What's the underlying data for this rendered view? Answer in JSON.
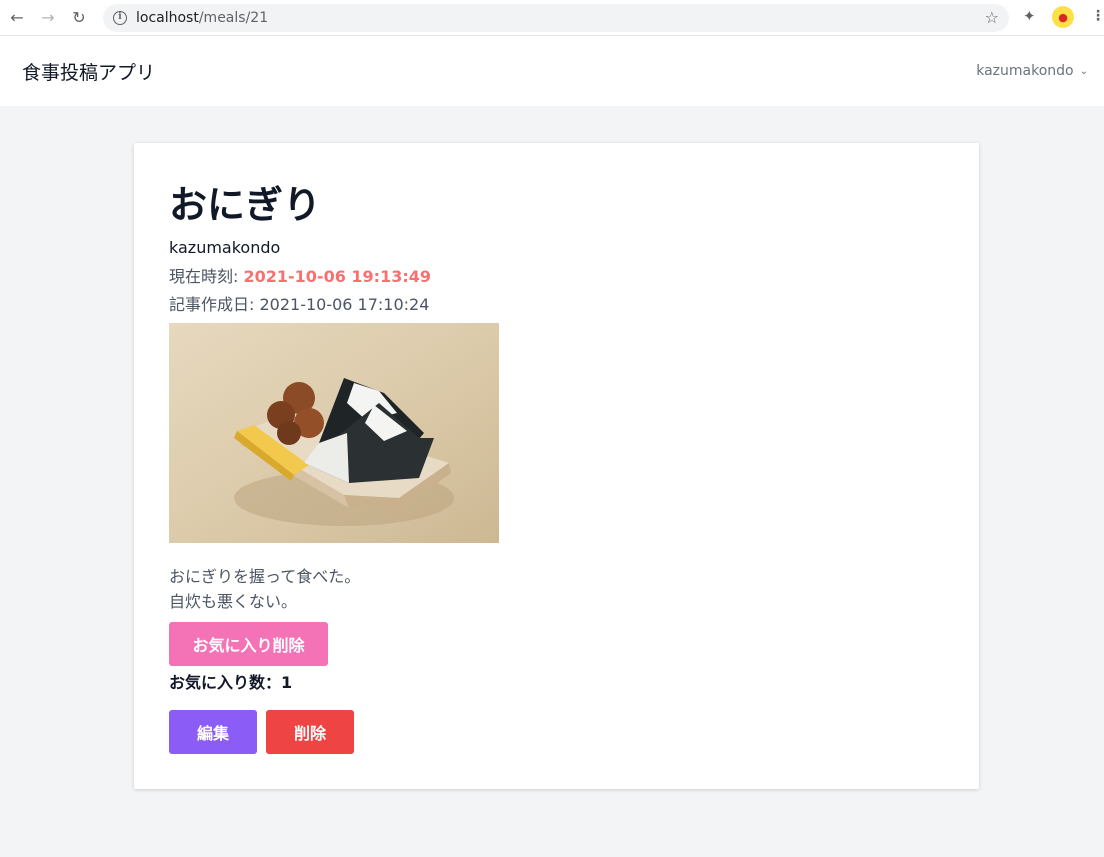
{
  "browser": {
    "url_host": "localhost",
    "url_path": "/meals/21"
  },
  "header": {
    "app_title": "食事投稿アプリ",
    "user_name": "kazumakondo"
  },
  "meal": {
    "title": "おにぎり",
    "author": "kazumakondo",
    "now_label": "現在時刻: ",
    "now_value": "2021-10-06 19:13:49",
    "created_label": "記事作成日: ",
    "created_value": "2021-10-06 17:10:24",
    "body_line1": "おにぎりを握って食べた。",
    "body_line2": "自炊も悪くない。",
    "favorite_button": "お気に入り削除",
    "favorite_count_label": "お気に入り数：",
    "favorite_count": "1",
    "edit_button": "編集",
    "delete_button": "削除"
  },
  "colors": {
    "accent_now": "#f87171",
    "favorite": "#f472b6",
    "edit": "#8b5cf6",
    "delete": "#ef4444"
  },
  "icons": [
    "back-arrow-icon",
    "forward-arrow-icon",
    "reload-icon",
    "info-icon",
    "star-icon",
    "puzzle-icon",
    "profile-icon",
    "kebab-menu-icon",
    "chevron-down-icon"
  ]
}
